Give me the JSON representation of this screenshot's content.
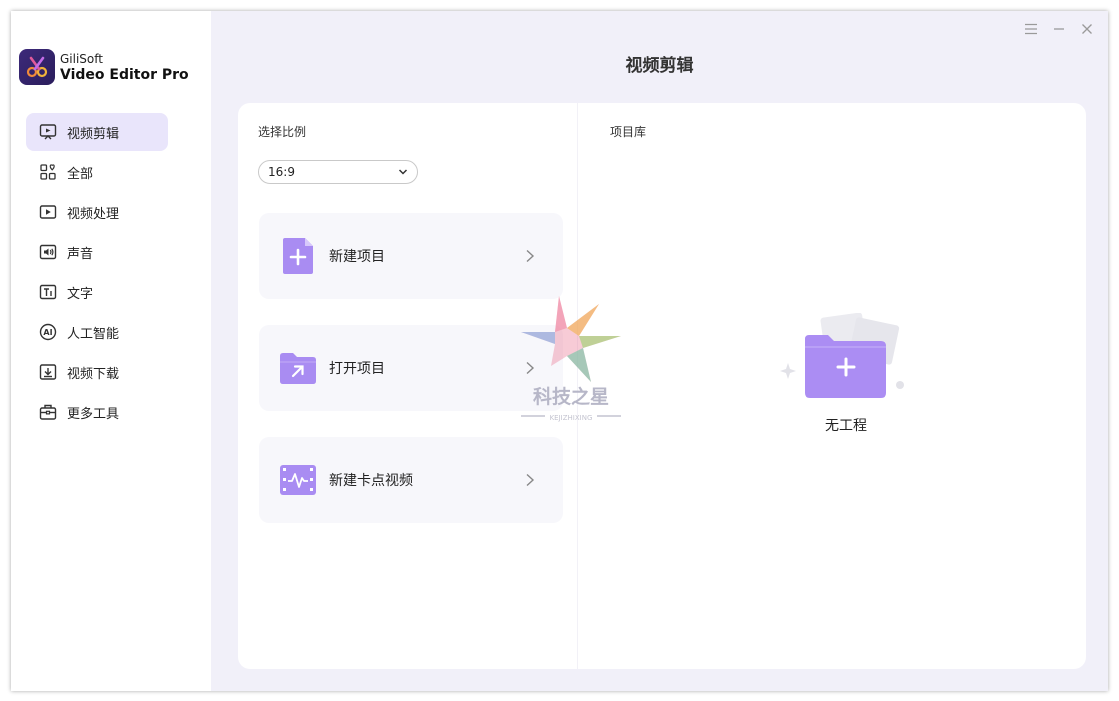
{
  "app": {
    "brand_line1": "GiliSoft",
    "brand_line2": "Video Editor Pro"
  },
  "window_controls": [
    {
      "name": "menu-icon"
    },
    {
      "name": "minimize-icon"
    },
    {
      "name": "close-icon"
    }
  ],
  "sidebar": {
    "items": [
      {
        "label": "视频剪辑",
        "icon": "video-edit-icon",
        "active": true
      },
      {
        "label": "全部",
        "icon": "all-apps-icon"
      },
      {
        "label": "视频处理",
        "icon": "video-process-icon"
      },
      {
        "label": "声音",
        "icon": "audio-icon"
      },
      {
        "label": "文字",
        "icon": "text-icon"
      },
      {
        "label": "人工智能",
        "icon": "ai-icon"
      },
      {
        "label": "视频下载",
        "icon": "download-icon"
      },
      {
        "label": "更多工具",
        "icon": "toolbox-icon"
      }
    ]
  },
  "main": {
    "title": "视频剪辑",
    "ratio_label": "选择比例",
    "ratio_value": "16:9",
    "actions": [
      {
        "label": "新建项目",
        "icon": "new-file-icon"
      },
      {
        "label": "打开项目",
        "icon": "open-folder-icon"
      },
      {
        "label": "新建卡点视频",
        "icon": "beat-video-icon"
      }
    ],
    "library_label": "项目库",
    "empty_text": "无工程"
  },
  "watermark": {
    "text": "科技之星",
    "subtext": "KEJIZHIXING"
  },
  "colors": {
    "accent": "#9d7cf0",
    "active_bg": "#e9e5fb",
    "window_bg": "#f1f0f9"
  }
}
